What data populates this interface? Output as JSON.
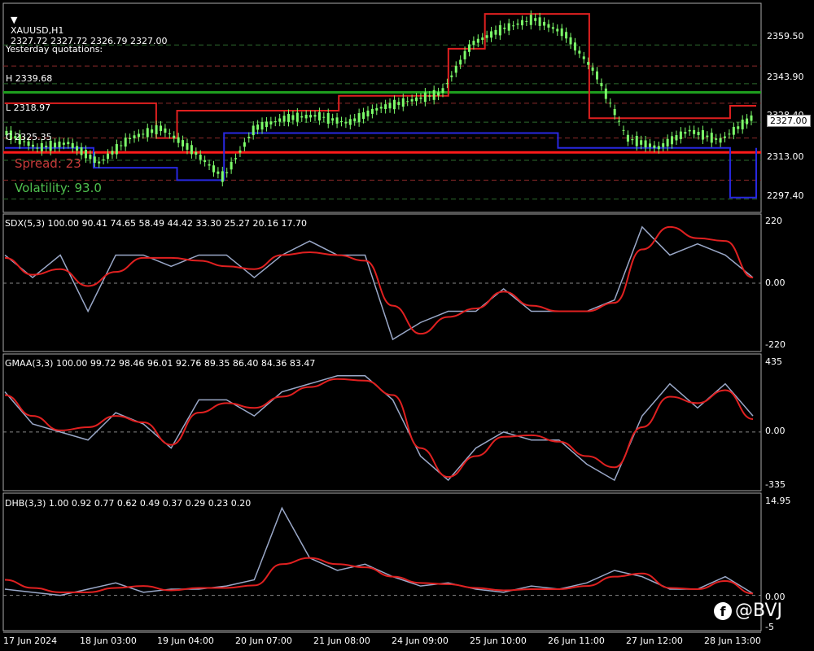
{
  "header": {
    "symbol": "XAUUSD,H1",
    "ohlc": "2327.72 2327.72 2326.79 2327.00",
    "yesterday_title": "Yesterday quotations:",
    "yesterday_high": "H 2339.68",
    "yesterday_low": "L 2318.97",
    "yesterday_close": "C 2325.35",
    "spread": "Spread: 23",
    "volatility": "Volatility: 93.0",
    "current_price": "2327.00"
  },
  "time_axis": [
    "17 Jun 2024",
    "18 Jun 03:00",
    "19 Jun 04:00",
    "20 Jun 07:00",
    "21 Jun 08:00",
    "24 Jun 09:00",
    "25 Jun 10:00",
    "26 Jun 11:00",
    "27 Jun 12:00",
    "28 Jun 13:00"
  ],
  "watermark": "@BVJ",
  "colors": {
    "candle": "#7CFC6A",
    "upper_band": "#E02020",
    "lower_band": "#2828E0",
    "signal": "#E02020",
    "oscillator": "#9AA8C8",
    "green_level": "#1E9E1E",
    "red_level": "#FF1A1A"
  },
  "chart_data": [
    {
      "type": "line",
      "title": "XAUUSD,H1",
      "y_ticks": [
        "2359.50",
        "2343.90",
        "2328.40",
        "2313.00",
        "2297.40"
      ],
      "ylim": [
        2293,
        2375
      ],
      "levels": [
        {
          "value": 2340.4,
          "color": "green"
        },
        {
          "value": 2316.2,
          "color": "red"
        }
      ],
      "x": [
        0,
        7,
        12,
        17,
        22,
        29,
        33,
        38,
        42,
        48,
        56,
        64,
        72,
        79,
        85,
        92,
        99,
        106,
        112,
        117,
        122,
        128,
        134,
        139,
        144
      ],
      "close": [
        2324,
        2318,
        2320,
        2312,
        2322,
        2326,
        2317,
        2306,
        2326,
        2330,
        2331,
        2328,
        2334,
        2337,
        2340,
        2360,
        2366,
        2370,
        2364,
        2348,
        2322,
        2318,
        2325,
        2321,
        2330
      ],
      "series": [
        {
          "name": "upper",
          "values": [
            2336,
            2336,
            2336,
            2336,
            2336,
            2322,
            2333,
            2333,
            2333,
            2333,
            2333,
            2339,
            2339,
            2339,
            2358,
            2372,
            2372,
            2372,
            2330,
            2330,
            2330,
            2330,
            2330,
            2335,
            2335
          ]
        },
        {
          "name": "lower",
          "values": [
            2318,
            2318,
            2318,
            2310,
            2310,
            2310,
            2305,
            2305,
            2324,
            2324,
            2324,
            2324,
            2324,
            2324,
            2324,
            2324,
            2324,
            2318,
            2318,
            2318,
            2318,
            2318,
            2318,
            2298,
            2318
          ]
        }
      ]
    },
    {
      "type": "line",
      "title": "SDX(5,3) 100.00 90.41 74.65 58.49 44.42 33.30 25.27 20.16 17.70",
      "y_ticks": [
        "220",
        "0.00",
        "-220"
      ],
      "ylim": [
        -220,
        220
      ],
      "series": [
        {
          "name": "",
          "values": [
            100,
            20,
            100,
            -100,
            100,
            100,
            60,
            100,
            100,
            20,
            100,
            150,
            100,
            100,
            -200,
            -140,
            -100,
            -100,
            -20,
            -100,
            -100,
            -100,
            -60,
            200,
            100,
            140,
            100,
            20
          ]
        },
        {
          "name": "",
          "values": [
            90,
            30,
            50,
            -10,
            40,
            90,
            90,
            80,
            60,
            50,
            100,
            110,
            100,
            80,
            -80,
            -180,
            -120,
            -90,
            -30,
            -80,
            -100,
            -100,
            -70,
            120,
            200,
            160,
            150,
            20
          ]
        }
      ]
    },
    {
      "type": "line",
      "title": "GMAA(3,3) 100.00 99.72 98.46 96.01 92.76 89.35 86.40 84.36 83.47",
      "y_ticks": [
        "435",
        "0.00",
        "-335"
      ],
      "ylim": [
        -335,
        435
      ],
      "series": [
        {
          "name": "",
          "values": [
            250,
            50,
            0,
            -50,
            120,
            50,
            -100,
            200,
            200,
            100,
            250,
            300,
            350,
            350,
            200,
            -150,
            -300,
            -100,
            0,
            -50,
            -50,
            -200,
            -300,
            100,
            300,
            150,
            300,
            100
          ]
        },
        {
          "name": "",
          "values": [
            230,
            100,
            10,
            30,
            100,
            60,
            -80,
            120,
            180,
            150,
            220,
            280,
            330,
            320,
            230,
            -100,
            -280,
            -150,
            -30,
            -20,
            -60,
            -150,
            -220,
            30,
            220,
            180,
            260,
            80
          ]
        }
      ]
    },
    {
      "type": "line",
      "title": "DHB(3,3) 1.00 0.92 0.77 0.62 0.49 0.37 0.29 0.23 0.20",
      "y_ticks": [
        "14.95",
        "0.00",
        "-5"
      ],
      "ylim": [
        -5,
        14.95
      ],
      "series": [
        {
          "name": "",
          "values": [
            1,
            0.5,
            0,
            1,
            2,
            0.5,
            1,
            1,
            1.5,
            2.5,
            14,
            6,
            4,
            5,
            3,
            1.5,
            2,
            1,
            0.5,
            1.5,
            1,
            2,
            4,
            3,
            1,
            1,
            3,
            0.3
          ]
        },
        {
          "name": "",
          "values": [
            2.5,
            1.2,
            0.5,
            0.5,
            1.2,
            1.5,
            0.8,
            1.2,
            1.2,
            1.6,
            5,
            6,
            5,
            4.5,
            3,
            2,
            1.8,
            1.2,
            0.8,
            1,
            1,
            1.5,
            3,
            3.5,
            1.2,
            1,
            2.3,
            0.3
          ]
        }
      ]
    }
  ]
}
